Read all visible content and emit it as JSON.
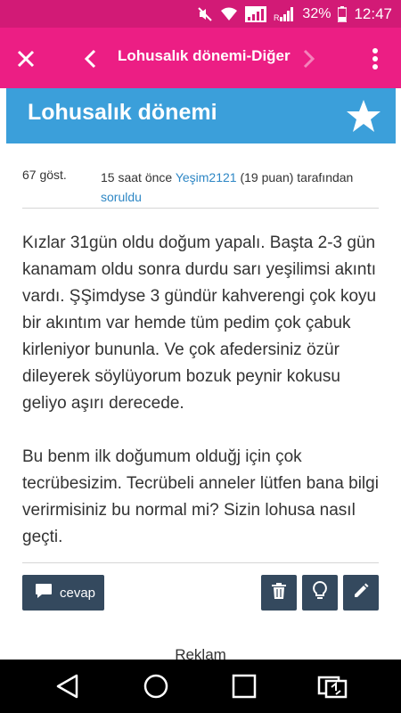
{
  "status_bar": {
    "battery": "32%",
    "time": "12:47",
    "icons": [
      "mute-icon",
      "wifi-icon",
      "signal-icon",
      "signal-r-icon",
      "battery-icon"
    ]
  },
  "app_bar": {
    "title": "Lohusalık dönemi-Diğer",
    "icons": [
      "close-icon",
      "back-icon",
      "forward-icon",
      "more-icon"
    ]
  },
  "category": {
    "title": "Lohusalık dönemi",
    "icon": "star-icon"
  },
  "question": {
    "views": "67 göst.",
    "time_prefix": "15 saat önce ",
    "author": "Yeşim2121",
    "author_points": " (19 puan) tarafından",
    "asked_label": "soruldu",
    "paragraphs": [
      "Kızlar 31gün oldu doğum yapalı. Başta 2-3 gün kanamam oldu sonra durdu sarı yeşilimsi akıntı vardı. ŞŞimdyse 3 gündür kahverengi çok koyu bir akıntım var hemde tüm pedim çok çabuk kirleniyor bununla. Ve çok afedersiniz özür dileyerek söylüyorum bozuk peynir kokusu geliyo aşırı derecede.",
      "Bu benm ilk doğumum olduğj için çok tecrübesizim. Tecrübeli anneler lütfen bana bilgi verirmisiniz bu normal mi? Sizin lohusa nasıl geçti."
    ]
  },
  "actions": {
    "reply_label": "cevap",
    "icons": [
      "comment-icon",
      "trash-icon",
      "bulb-icon",
      "edit-icon"
    ]
  },
  "ad_label": "Reklam",
  "nav_bar": {
    "icons": [
      "nav-back-icon",
      "nav-home-icon",
      "nav-recents-icon",
      "nav-switch-icon"
    ]
  }
}
